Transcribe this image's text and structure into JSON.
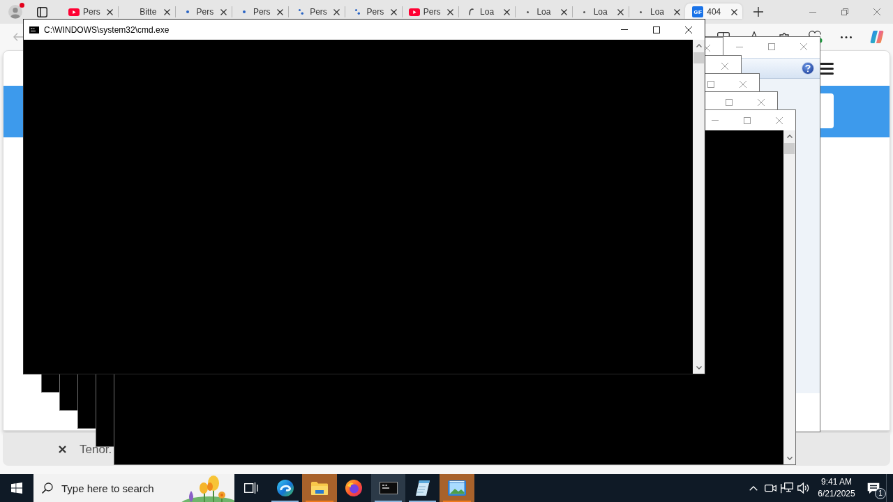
{
  "browser": {
    "profile": {
      "alert": true
    },
    "tabs": [
      {
        "title": "Pers",
        "kind": "youtube",
        "selected": false
      },
      {
        "title": "Bitte",
        "kind": "none",
        "selected": false
      },
      {
        "title": "Pers",
        "kind": "dot",
        "selected": false
      },
      {
        "title": "Pers",
        "kind": "dot",
        "selected": false
      },
      {
        "title": "Pers",
        "kind": "dots",
        "selected": false
      },
      {
        "title": "Pers",
        "kind": "dots",
        "selected": false
      },
      {
        "title": "Pers",
        "kind": "youtube",
        "selected": false
      },
      {
        "title": "Loa",
        "kind": "spinner",
        "selected": false
      },
      {
        "title": "Loa",
        "kind": "small-dot",
        "selected": false
      },
      {
        "title": "Loa",
        "kind": "small-dot",
        "selected": false
      },
      {
        "title": "Loa",
        "kind": "small-dot",
        "selected": false
      },
      {
        "title": "404",
        "kind": "gif",
        "favicon_text": "GIF",
        "selected": true
      }
    ],
    "page": {
      "bottom_bar": {
        "text": "Tenor."
      }
    }
  },
  "dialog": {
    "controls": [
      {
        "kind": "minimize"
      },
      {
        "kind": "maximize"
      },
      {
        "kind": "close"
      }
    ]
  },
  "console_windows": [
    {
      "title": "C:\\WINDOWS\\system32\\cmd.exe",
      "active": true,
      "controls": [
        {
          "kind": "minimize"
        },
        {
          "kind": "maximize"
        },
        {
          "kind": "close"
        }
      ]
    },
    {
      "active": false,
      "controls": [
        {
          "kind": "close"
        }
      ]
    },
    {
      "active": false,
      "controls": [
        {
          "kind": "close"
        }
      ]
    },
    {
      "active": false,
      "controls": [
        {
          "kind": "maximize"
        },
        {
          "kind": "close"
        }
      ]
    },
    {
      "active": false,
      "controls": [
        {
          "kind": "maximize"
        },
        {
          "kind": "close"
        }
      ]
    },
    {
      "active": false,
      "controls": [
        {
          "kind": "minimize"
        },
        {
          "kind": "maximize"
        },
        {
          "kind": "close"
        }
      ]
    }
  ],
  "taskbar": {
    "search": {
      "placeholder": "Type here to search"
    },
    "apps": [
      {
        "kind": "edge",
        "running": true,
        "active": false,
        "flashing": false
      },
      {
        "kind": "explorer",
        "running": true,
        "active": false,
        "flashing": true
      },
      {
        "kind": "firefox",
        "running": false,
        "active": false,
        "flashing": false
      },
      {
        "kind": "console",
        "running": true,
        "active": true,
        "flashing": false
      },
      {
        "kind": "notepad",
        "running": true,
        "active": false,
        "flashing": false
      },
      {
        "kind": "picture",
        "running": true,
        "active": false,
        "flashing": true
      }
    ],
    "clock": {
      "time": "9:41 AM",
      "date": "6/21/2025"
    },
    "notifications": {
      "count": "1"
    }
  }
}
